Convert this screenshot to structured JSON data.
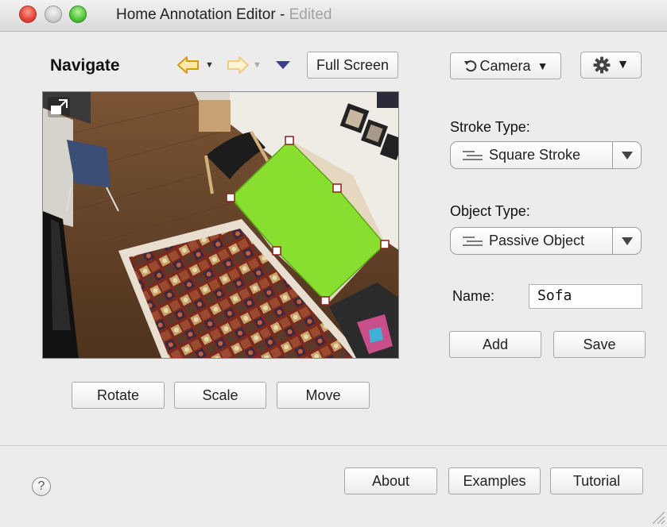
{
  "window": {
    "title": "Home Annotation Editor",
    "title_separator": " - ",
    "edited": "Edited"
  },
  "toolbar": {
    "nav_title": "Navigate",
    "back_icon": "left-arrow-icon",
    "forward_icon": "right-arrow-icon",
    "full_screen": "Full Screen",
    "camera": "Camera",
    "camera_icon": "rotate-icon",
    "settings_icon": "gear-icon"
  },
  "viewport": {
    "expand_icon": "expand-icon",
    "selection_color": "#7ee01f"
  },
  "transform": {
    "rotate": "Rotate",
    "scale": "Scale",
    "move": "Move"
  },
  "panel": {
    "stroke_type_label": "Stroke Type:",
    "stroke_type_value": "Square Stroke",
    "object_type_label": "Object Type:",
    "object_type_value": "Passive Object",
    "name_label": "Name:",
    "name_value": "Sofa",
    "add": "Add",
    "save": "Save"
  },
  "footer": {
    "help_icon": "question-icon",
    "help_glyph": "?",
    "about": "About",
    "examples": "Examples",
    "tutorial": "Tutorial"
  }
}
